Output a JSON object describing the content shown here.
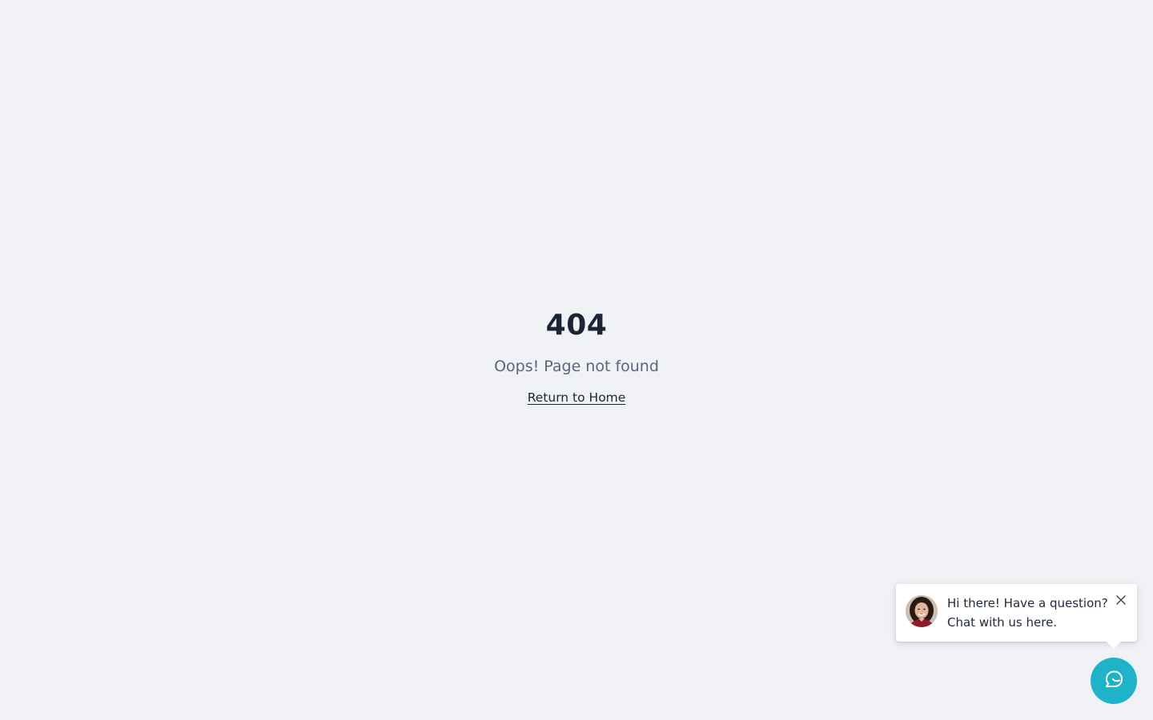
{
  "not_found": {
    "code": "404",
    "message": "Oops! Page not found",
    "home_link": "Return to Home"
  },
  "chat_widget": {
    "greeting_line1": "Hi there! Have a question?",
    "greeting_line2": "Chat with us here.",
    "avatar_icon": "agent-avatar",
    "close_icon": "close-icon",
    "launcher_icon": "chat-bubble-icon",
    "launcher_color": "#1fb3c9"
  },
  "colors": {
    "background": "#f0f2f6",
    "heading": "#1b2535",
    "muted_text": "#5a6678"
  }
}
